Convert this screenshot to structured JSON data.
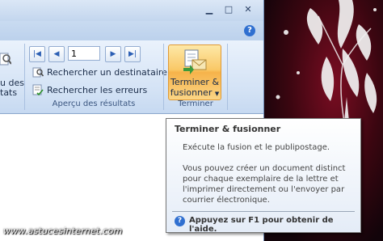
{
  "ribbon": {
    "left_partial": {
      "line1": "u des",
      "line2": "tats"
    },
    "preview_group": {
      "record_number": "1",
      "find_recipient_label": "Rechercher un destinataire",
      "check_errors_label": "Rechercher les erreurs",
      "group_label": "Aperçu des résultats"
    },
    "finish_group": {
      "button_line1": "Terminer &",
      "button_line2": "fusionner",
      "group_label": "Terminer"
    }
  },
  "tooltip": {
    "title": "Terminer & fusionner",
    "line1": "Exécute la fusion et le publipostage.",
    "para2": [
      "Vous pouvez créer un document distinct",
      "pour chaque exemplaire de la lettre et",
      "l'imprimer directement ou l'envoyer par",
      "courrier électronique."
    ],
    "help": "Appuyez sur F1 pour obtenir de l'aide."
  },
  "watermark": "www.astucesinternet.com",
  "colors": {
    "ribbon": "#d3e2f5",
    "highlight": "#f9c867",
    "desktop": "#7a0d22"
  }
}
